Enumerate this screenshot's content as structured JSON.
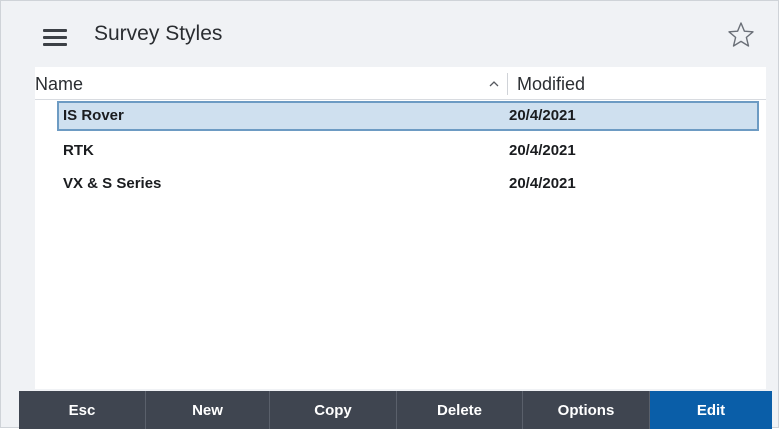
{
  "header": {
    "title": "Survey Styles",
    "menu_icon": "hamburger-menu-icon",
    "favorite_icon": "star-outline-icon"
  },
  "table": {
    "columns": [
      {
        "label": "Name",
        "sort": "ascending"
      },
      {
        "label": "Modified"
      }
    ],
    "rows": [
      {
        "name": "IS Rover",
        "modified": "20/4/2021",
        "selected": true
      },
      {
        "name": "RTK",
        "modified": "20/4/2021",
        "selected": false
      },
      {
        "name": "VX & S Series",
        "modified": "20/4/2021",
        "selected": false
      }
    ]
  },
  "footer": {
    "buttons": [
      {
        "label": "Esc"
      },
      {
        "label": "New"
      },
      {
        "label": "Copy"
      },
      {
        "label": "Delete"
      },
      {
        "label": "Options"
      },
      {
        "label": "Edit",
        "primary": true
      }
    ]
  },
  "colors": {
    "footer_bg": "#3f4550",
    "primary_button": "#0a5ea8",
    "selection_bg": "#cfe0ef",
    "selection_border": "#6d9bc3"
  }
}
